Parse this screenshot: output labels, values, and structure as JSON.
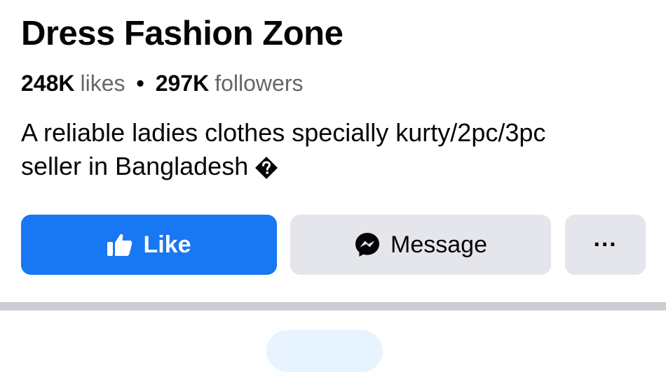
{
  "page": {
    "title": "Dress Fashion Zone",
    "stats": {
      "likes_count": "248K",
      "likes_label": "likes",
      "separator": "•",
      "followers_count": "297K",
      "followers_label": "followers"
    },
    "bio": {
      "line1": "A reliable ladies clothes specially kurty/2pc/3pc",
      "line2": "seller in Bangladesh"
    }
  },
  "actions": {
    "like_label": "Like",
    "message_label": "Message",
    "more_label": "···"
  },
  "icons": {
    "like": "thumbs-up-icon",
    "message": "messenger-icon",
    "bio_symbol": "unknown-character-icon"
  },
  "colors": {
    "primary": "#1877f2",
    "secondary_button": "#e4e6eb",
    "muted_text": "#65676b",
    "separator": "#ccced3"
  }
}
